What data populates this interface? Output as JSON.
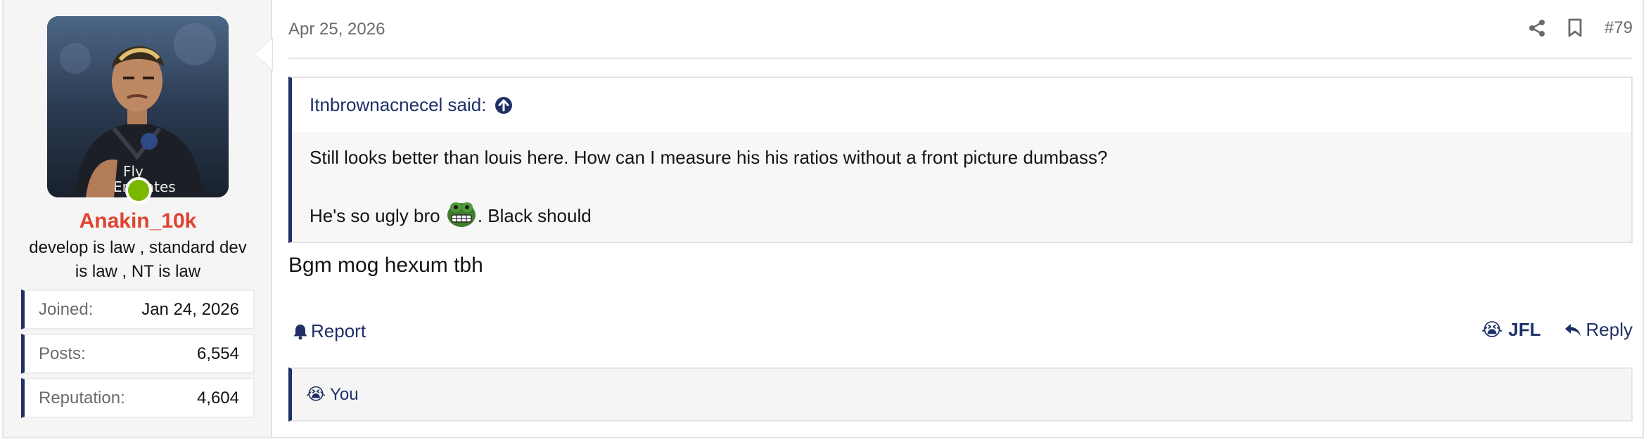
{
  "user": {
    "avatar_icon": "user-avatar-photo",
    "online_color": "#7ab800",
    "name": "Anakin_10k",
    "name_color": "#e0432f",
    "title": "develop is law , standard dev is law , NT is law",
    "stats": [
      {
        "label": "Joined:",
        "value": "Jan 24, 2026"
      },
      {
        "label": "Posts:",
        "value": "6,554"
      },
      {
        "label": "Reputation:",
        "value": "4,604"
      }
    ]
  },
  "post": {
    "date": "Apr 25, 2026",
    "number": "#79",
    "share_icon": "share-icon",
    "bookmark_icon": "bookmark-icon",
    "quote": {
      "author_label": "Itnbrownacnecel said:",
      "line1": "Still looks better than louis here. How can I measure his his ratios without a front picture dumbass?",
      "line2_before": "He's so ugly bro ",
      "line2_after": ". Black should",
      "emoji_icon": "pepe-grimace-icon"
    },
    "body": "Bgm mog hexum tbh",
    "actions": {
      "report_label": "Report",
      "reaction_emoji": "😭",
      "reaction_label": "JFL",
      "reply_label": "Reply"
    },
    "reactions_bar": {
      "emoji": "😭",
      "text": "You"
    }
  },
  "colors": {
    "accent": "#1e3066",
    "muted": "#6b6b6b"
  }
}
